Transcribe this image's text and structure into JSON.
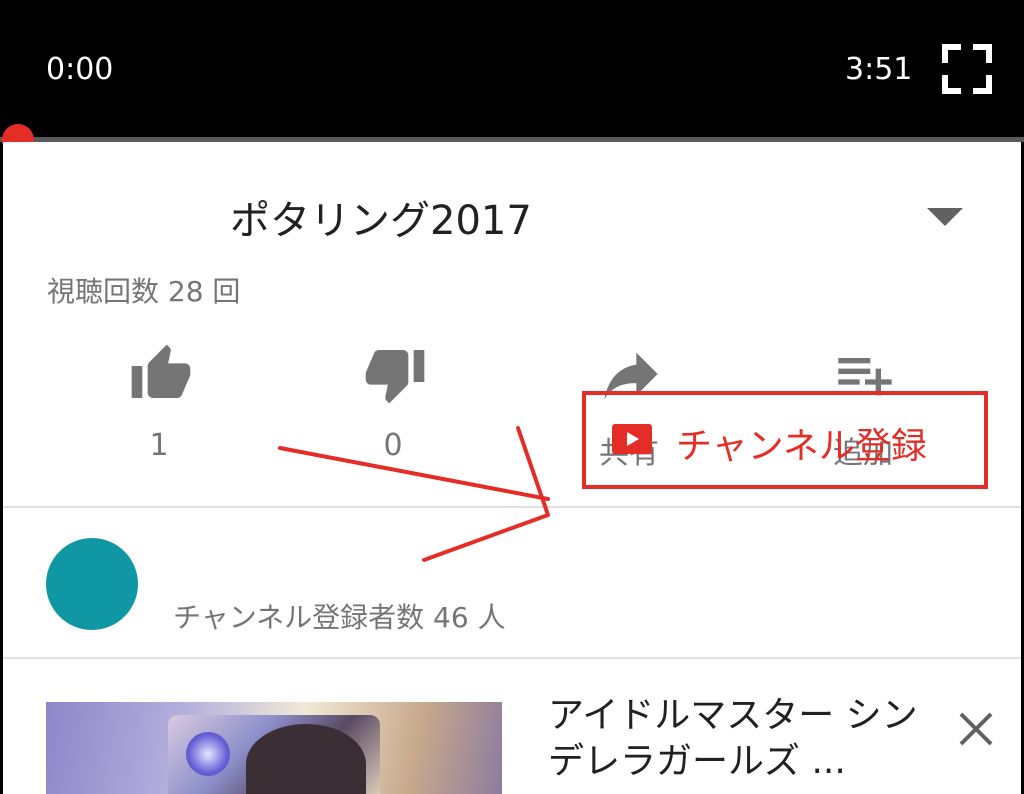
{
  "player": {
    "current_time": "0:00",
    "duration": "3:51",
    "progress_fraction": 0.0,
    "fullscreen_icon": "fullscreen-icon"
  },
  "video": {
    "title": "ポタリング2017",
    "views": "視聴回数 28 回"
  },
  "actions": [
    {
      "icon": "thumbs-up-icon",
      "label": "1"
    },
    {
      "icon": "thumbs-down-icon",
      "label": "0"
    },
    {
      "icon": "share-icon",
      "label": "共有"
    },
    {
      "icon": "playlist-add-icon",
      "label": "追加"
    }
  ],
  "channel": {
    "avatar_color": "#0f97a4",
    "subscribers": "チャンネル登録者数 46 人",
    "subscribe_label": "チャンネル登録",
    "subscribe_icon": "play-icon"
  },
  "recommendation": {
    "title": "アイドルマスター シンデレラガールズ ...",
    "dismiss_icon": "close-icon"
  },
  "colors": {
    "accent_red": "#e52d27",
    "player_bg": "#000000",
    "text_secondary": "#757575",
    "avatar": "#0f97a4"
  }
}
